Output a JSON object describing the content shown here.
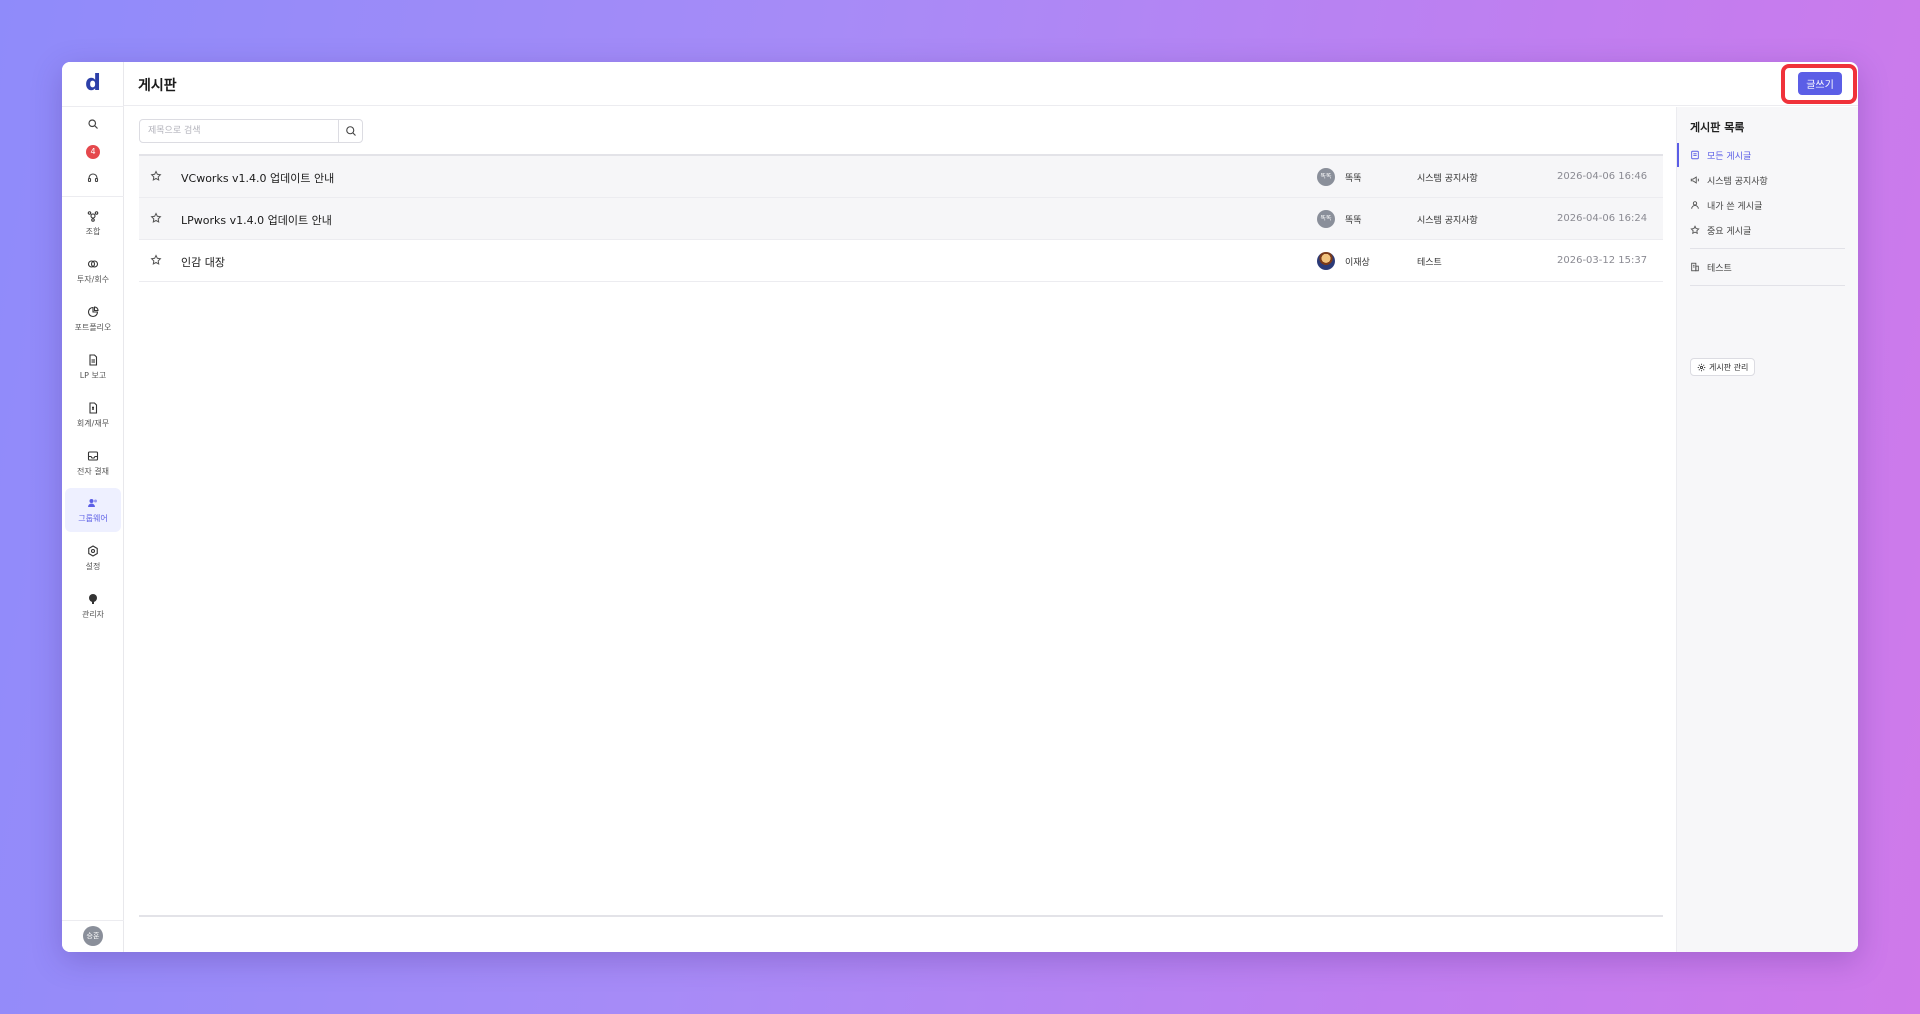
{
  "app": {
    "logo": "d",
    "title": "게시판"
  },
  "rail": {
    "notification_count": "4",
    "nav_items": [
      {
        "label": "조합",
        "icon": "fund-icon"
      },
      {
        "label": "투자/회수",
        "icon": "invest-icon"
      },
      {
        "label": "포트폴리오",
        "icon": "portfolio-icon"
      },
      {
        "label": "LP 보고",
        "icon": "report-icon"
      },
      {
        "label": "회계/재무",
        "icon": "accounting-icon"
      },
      {
        "label": "전자 결재",
        "icon": "approval-icon"
      },
      {
        "label": "그룹웨어",
        "icon": "groupware-icon"
      },
      {
        "label": "설정",
        "icon": "settings-icon"
      },
      {
        "label": "관리자",
        "icon": "admin-icon"
      }
    ],
    "active_nav": "그룹웨어",
    "user_initials": "승훈"
  },
  "header": {
    "write_label": "글쓰기"
  },
  "search": {
    "placeholder": "제목으로 검색",
    "value": ""
  },
  "posts": [
    {
      "title": "VCworks v1.4.0 업데이트 안내",
      "author": "똑똑",
      "author_initials": "똑똑",
      "board": "시스템 공지사항",
      "date": "2026-04-06 16:46"
    },
    {
      "title": "LPworks v1.4.0 업데이트 안내",
      "author": "똑똑",
      "author_initials": "똑똑",
      "board": "시스템 공지사항",
      "date": "2026-04-06 16:24"
    },
    {
      "title": "인감 대장",
      "author": "이재상",
      "author_initials": "",
      "board": "테스트",
      "date": "2026-03-12 15:37"
    }
  ],
  "panel": {
    "title": "게시판 목록",
    "items": [
      {
        "label": "모든 게시글",
        "icon": "list-icon",
        "active": true
      },
      {
        "label": "시스템 공지사항",
        "icon": "megaphone-icon",
        "active": false
      },
      {
        "label": "내가 쓴 게시글",
        "icon": "user-icon",
        "active": false
      },
      {
        "label": "중요 게시글",
        "icon": "star-icon",
        "active": false
      },
      {
        "label": "테스트",
        "icon": "building-icon",
        "active": false
      }
    ],
    "manage_label": "게시판 관리"
  },
  "colors": {
    "accent": "#5b5ee6",
    "highlight": "#f0323a",
    "badge": "#e5484d"
  }
}
